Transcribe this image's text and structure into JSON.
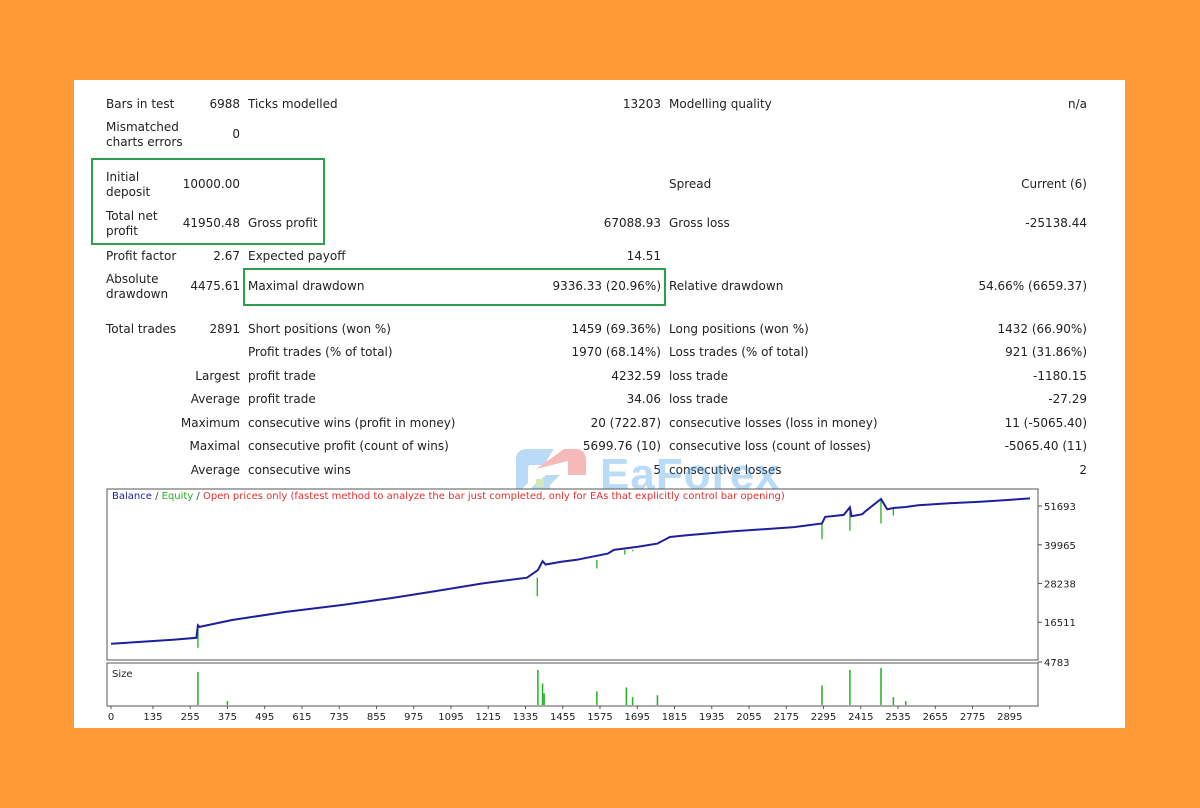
{
  "report": {
    "rows": [
      {
        "label": "Bars in test",
        "value": "6988",
        "label2": "Ticks modelled",
        "value2": "13203",
        "label3": "Modelling quality",
        "value3": "n/a"
      },
      {
        "label": "Mismatched charts errors",
        "value": "0"
      },
      {
        "label": "Initial deposit",
        "value": "10000.00",
        "label3": "Spread",
        "value3": "Current (6)"
      },
      {
        "label": "Total net profit",
        "value": "41950.48",
        "label2": "Gross profit",
        "value2": "67088.93",
        "label3": "Gross loss",
        "value3": "-25138.44"
      },
      {
        "label": "Profit factor",
        "value": "2.67",
        "label2": "Expected payoff",
        "value2": "14.51"
      },
      {
        "label": "Absolute drawdown",
        "value": "4475.61",
        "label2": "Maximal drawdown",
        "value2": "9336.33 (20.96%)",
        "label3": "Relative drawdown",
        "value3": "54.66% (6659.37)"
      },
      {
        "label": "Total trades",
        "value": "2891",
        "label2": "Short positions (won %)",
        "value2": "1459 (69.36%)",
        "label3": "Long positions (won %)",
        "value3": "1432 (66.90%)"
      },
      {
        "label2": "Profit trades (% of total)",
        "value2": "1970 (68.14%)",
        "label3": "Loss trades (% of total)",
        "value3": "921 (31.86%)"
      },
      {
        "value": "Largest",
        "label2": "profit trade",
        "value2": "4232.59",
        "label3": "loss trade",
        "value3": "-1180.15"
      },
      {
        "value": "Average",
        "label2": "profit trade",
        "value2": "34.06",
        "label3": "loss trade",
        "value3": "-27.29"
      },
      {
        "value": "Maximum",
        "label2": "consecutive wins (profit in money)",
        "value2": "20 (722.87)",
        "label3": "consecutive losses (loss in money)",
        "value3": "11 (-5065.40)"
      },
      {
        "value": "Maximal",
        "label2": "consecutive profit (count of wins)",
        "value2": "5699.76 (10)",
        "label3": "consecutive loss (count of losses)",
        "value3": "-5065.40 (11)"
      },
      {
        "value": "Average",
        "label2": "consecutive wins",
        "value2": "5",
        "label3": "consecutive losses",
        "value3": "2"
      }
    ]
  },
  "watermark": {
    "text": "EaForex"
  },
  "legend": {
    "balance": "Balance",
    "sep1": " / ",
    "equity": "Equity",
    "sep2": " / ",
    "note": "Open prices only (fastest method to analyze the bar just completed, only for EAs that explicitly control bar opening)"
  },
  "size_label": "Size",
  "colors": {
    "balance": "#1F1F9E",
    "equity": "#22B022",
    "note": "#E03030",
    "highlight": "#2E9E4F",
    "background": "#FF9A36"
  },
  "chart_data": {
    "type": "line",
    "x_ticks": [
      "0",
      "135",
      "255",
      "375",
      "495",
      "615",
      "735",
      "855",
      "975",
      "1095",
      "1215",
      "1335",
      "1455",
      "1575",
      "1695",
      "1815",
      "1935",
      "2055",
      "2175",
      "2295",
      "2415",
      "2535",
      "2655",
      "2775",
      "2895"
    ],
    "y_ticks": [
      "51693",
      "39965",
      "28238",
      "16511",
      "4783"
    ],
    "ylim": [
      4783,
      51693
    ],
    "xlim": [
      0,
      2960
    ],
    "series": [
      {
        "name": "Balance",
        "color": "#1F1F9E",
        "x": [
          0,
          100,
          200,
          275,
          280,
          285,
          390,
          560,
          750,
          900,
          1050,
          1200,
          1340,
          1375,
          1390,
          1400,
          1450,
          1500,
          1600,
          1620,
          1700,
          1760,
          1800,
          1850,
          2000,
          2200,
          2290,
          2300,
          2360,
          2380,
          2385,
          2420,
          2430,
          2480,
          2500,
          2520,
          2560,
          2600,
          2700,
          2800,
          2900,
          2960
        ],
        "y": [
          10000,
          10600,
          11200,
          11800,
          15600,
          15100,
          17200,
          19600,
          21800,
          23800,
          26000,
          28300,
          30000,
          32300,
          35000,
          34000,
          34800,
          35400,
          37300,
          38400,
          39400,
          40300,
          42300,
          42800,
          44000,
          45300,
          46400,
          48400,
          49000,
          51300,
          48600,
          49200,
          50100,
          53800,
          50700,
          51100,
          51400,
          51900,
          52500,
          53000,
          53600,
          54000
        ]
      },
      {
        "name": "Equity",
        "color": "#22B022",
        "dips": [
          [
            280,
            8800
          ],
          [
            1373,
            24400
          ],
          [
            1565,
            32800
          ],
          [
            1655,
            37000
          ],
          [
            1680,
            38000
          ],
          [
            2290,
            41600
          ],
          [
            2380,
            44200
          ],
          [
            2480,
            46400
          ],
          [
            2520,
            48800
          ]
        ]
      }
    ],
    "size_spikes": [
      [
        280,
        0.85
      ],
      [
        375,
        0.1
      ],
      [
        1375,
        0.9
      ],
      [
        1390,
        0.55
      ],
      [
        1395,
        0.3
      ],
      [
        1565,
        0.35
      ],
      [
        1660,
        0.45
      ],
      [
        1680,
        0.2
      ],
      [
        1760,
        0.25
      ],
      [
        2290,
        0.5
      ],
      [
        2380,
        0.9
      ],
      [
        2480,
        0.95
      ],
      [
        2520,
        0.2
      ],
      [
        2560,
        0.1
      ]
    ]
  }
}
